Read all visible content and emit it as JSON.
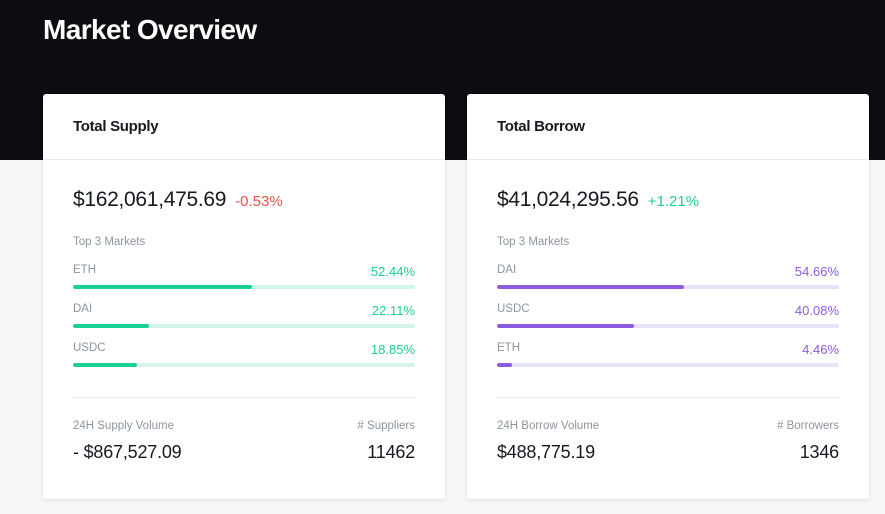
{
  "page": {
    "title": "Market Overview"
  },
  "colors": {
    "header_bg": "#0b0d10",
    "page_bg": "#f5f6f8",
    "supply_accent": "#1bd190",
    "supply_track": "#d3f6e9",
    "borrow_accent": "#8d5be0",
    "borrow_track": "#e8e1f7",
    "negative": "#e8534a",
    "positive": "#1bd190"
  },
  "supply": {
    "title": "Total Supply",
    "total": "$162,061,475.69",
    "change": "-0.53%",
    "change_direction": "negative",
    "top_markets_label": "Top 3 Markets",
    "markets": [
      {
        "name": "ETH",
        "percent": "52.44%",
        "fill": 0.5244
      },
      {
        "name": "DAI",
        "percent": "22.11%",
        "fill": 0.2211
      },
      {
        "name": "USDC",
        "percent": "18.85%",
        "fill": 0.1885
      }
    ],
    "volume_label": "24H Supply Volume",
    "volume_value": "- $867,527.09",
    "count_label": "# Suppliers",
    "count_value": "11462"
  },
  "borrow": {
    "title": "Total Borrow",
    "total": "$41,024,295.56",
    "change": "+1.21%",
    "change_direction": "positive",
    "top_markets_label": "Top 3 Markets",
    "markets": [
      {
        "name": "DAI",
        "percent": "54.66%",
        "fill": 0.5466
      },
      {
        "name": "USDC",
        "percent": "40.08%",
        "fill": 0.4008
      },
      {
        "name": "ETH",
        "percent": "4.46%",
        "fill": 0.0446
      }
    ],
    "volume_label": "24H Borrow Volume",
    "volume_value": "$488,775.19",
    "count_label": "# Borrowers",
    "count_value": "1346"
  }
}
